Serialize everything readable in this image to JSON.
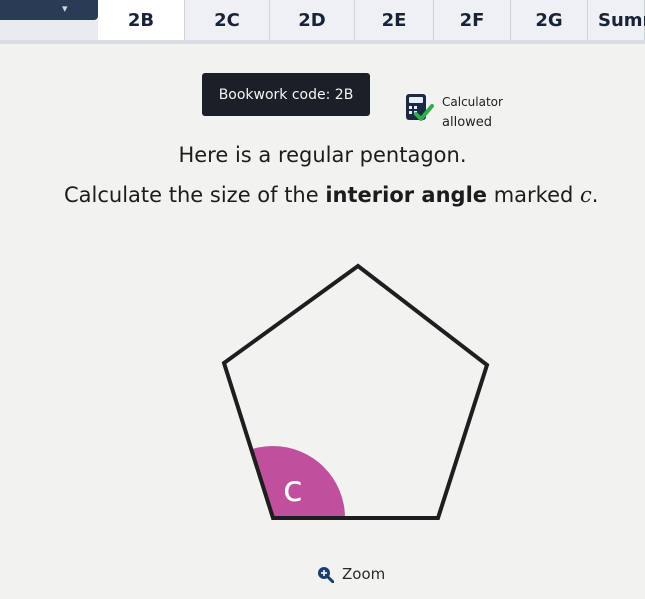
{
  "tabs": [
    {
      "label": "2B",
      "state": "active"
    },
    {
      "label": "2C",
      "state": "normal"
    },
    {
      "label": "2D",
      "state": "normal"
    },
    {
      "label": "2E",
      "state": "normal"
    },
    {
      "label": "2F",
      "state": "normal"
    },
    {
      "label": "2G",
      "state": "normal"
    },
    {
      "label": "Sumr",
      "state": "dark"
    }
  ],
  "bookwork": {
    "label": "Bookwork code: 2B"
  },
  "calculator": {
    "line1": "Calculator",
    "line2": "allowed",
    "icon": "calculator-icon"
  },
  "question": {
    "line1": "Here is a regular pentagon.",
    "line2_prefix": "Calculate the size of the ",
    "line2_bold": "interior angle",
    "line2_mid": " marked ",
    "line2_var": "c",
    "line2_end": "."
  },
  "figure": {
    "angle_label": "c",
    "angle_color": "#c0509e",
    "shape": "regular pentagon"
  },
  "zoom": {
    "label": "Zoom",
    "icon": "zoom-icon"
  }
}
